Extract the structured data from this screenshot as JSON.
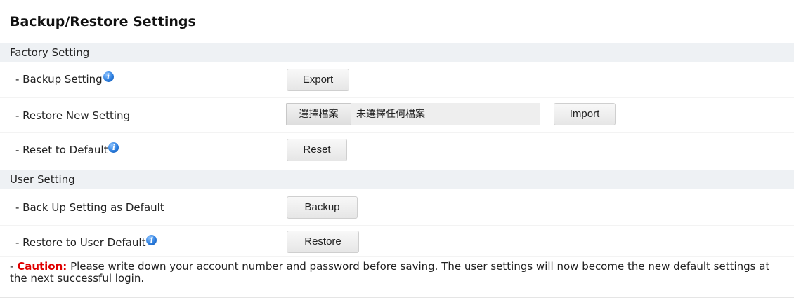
{
  "page": {
    "title": "Backup/Restore Settings"
  },
  "factory": {
    "header": "Factory Setting",
    "backup_label": "- Backup Setting",
    "export_button": "Export",
    "restore_label": "- Restore New Setting",
    "file_choose_button": "選擇檔案",
    "file_status": "未選擇任何檔案",
    "import_button": "Import",
    "reset_label": "- Reset to Default",
    "reset_button": "Reset"
  },
  "user": {
    "header": "User Setting",
    "backup_default_label": "- Back Up Setting as Default",
    "backup_button": "Backup",
    "restore_default_label": "- Restore to User Default",
    "restore_button": "Restore"
  },
  "caution": {
    "prefix": "- ",
    "label": "Caution:",
    "text": " Please write down your account number and password before saving. The user settings will now become the new default settings at the next successful login."
  },
  "icons": {
    "info": "info-icon"
  },
  "colors": {
    "title_rule": "#3a5c8f",
    "caution": "#e00000",
    "section_bg": "#eef1f4"
  }
}
